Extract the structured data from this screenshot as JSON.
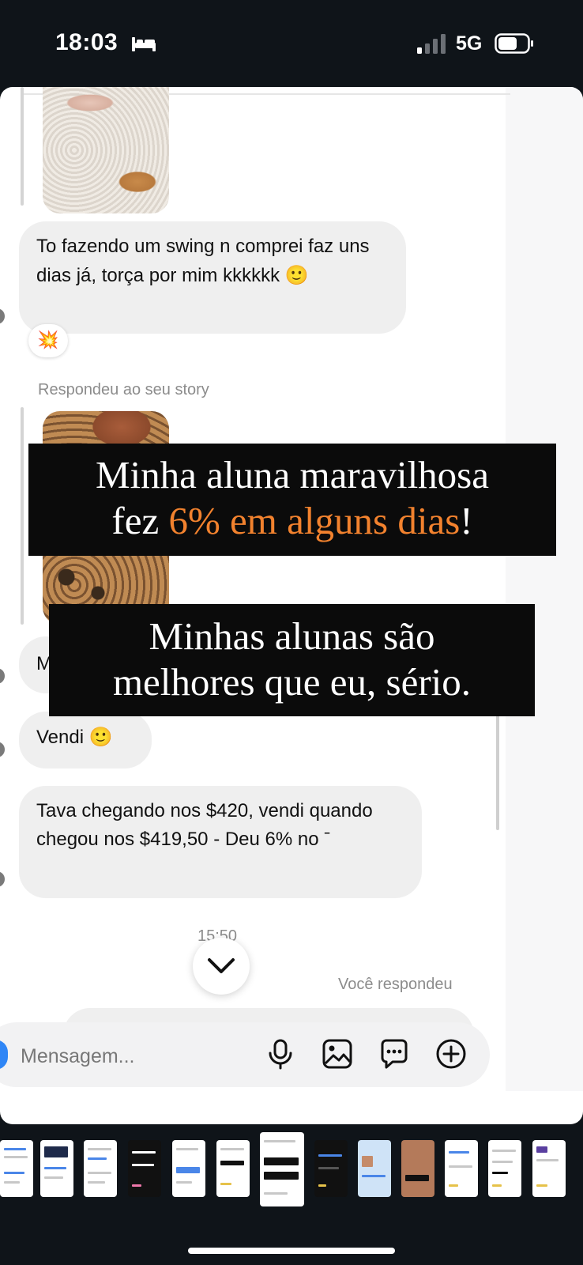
{
  "status_bar": {
    "time": "18:03",
    "network": "5G",
    "icons": [
      "bed-icon",
      "signal-icon",
      "battery-icon"
    ]
  },
  "chat": {
    "messages": [
      {
        "text": "To fazendo um swing n comprei faz uns dias já, torça por mim kkkkkk",
        "emoji": "🙂",
        "reaction": "💥"
      },
      {
        "text": "Vendi",
        "emoji": "🙂"
      },
      {
        "text": "Tava chegando nos $420, vendi quando chegou nos $419,50 - Deu 6% no ˉ"
      }
    ],
    "partial_bubble_text": "M",
    "story_reply_label": "Respondeu ao seu story",
    "timestamp": "15:50",
    "you_replied_label": "Você respondeu"
  },
  "overlay_captions": {
    "caption_1_line_1": "Minha aluna maravilhosa",
    "caption_1_line_2_prefix": "fez ",
    "caption_1_line_2_highlight": "6% em alguns dias",
    "caption_1_line_2_suffix": "!",
    "caption_2_line_1": "Minhas alunas são",
    "caption_2_line_2": "melhores que eu, sério.",
    "highlight_color": "#f2822e"
  },
  "composer": {
    "placeholder": "Mensagem...",
    "icons": [
      "microphone-icon",
      "image-icon",
      "sticker-icon",
      "plus-icon"
    ]
  },
  "colors": {
    "bubble_bg": "#efefef",
    "overlay_bg": "#0b0b0b",
    "accent_blue": "#2f86f6"
  }
}
